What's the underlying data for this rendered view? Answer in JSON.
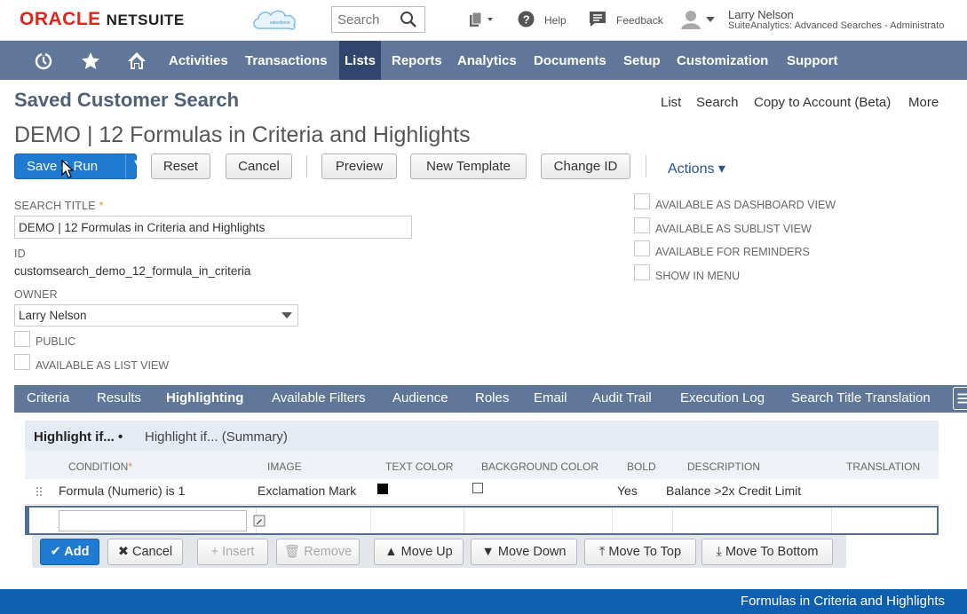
{
  "brand": {
    "oracle": "ORACLE",
    "netsuite": "NETSUITE"
  },
  "topbar": {
    "search_placeholder": "Search",
    "help_label": "Help",
    "feedback_label": "Feedback",
    "user_name": "Larry Nelson",
    "user_role": "SuiteAnalytics: Advanced Searches - Administrato",
    "icons": [
      "salesforce-cloud-icon",
      "search-icon",
      "create-new-icon",
      "help-icon",
      "feedback-icon",
      "user-icon"
    ]
  },
  "nav": {
    "icons": [
      "recent-records-icon",
      "favorites-star-icon",
      "home-icon"
    ],
    "items": [
      {
        "label": "Activities"
      },
      {
        "label": "Transactions"
      },
      {
        "label": "Lists",
        "active": true
      },
      {
        "label": "Reports"
      },
      {
        "label": "Analytics"
      },
      {
        "label": "Documents"
      },
      {
        "label": "Setup"
      },
      {
        "label": "Customization"
      },
      {
        "label": "Support"
      }
    ]
  },
  "page": {
    "type_title": "Saved Customer Search",
    "links": [
      "List",
      "Search",
      "Copy to Account (Beta)",
      "More"
    ],
    "record_title": "DEMO | 12 Formulas in Criteria and Highlights"
  },
  "buttons": {
    "save_run": "Save & Run",
    "reset": "Reset",
    "cancel": "Cancel",
    "preview": "Preview",
    "new_template": "New Template",
    "change_id": "Change ID",
    "actions": "Actions ▾"
  },
  "form": {
    "search_title_label": "SEARCH TITLE",
    "search_title_value": "DEMO | 12 Formulas in Criteria and Highlights",
    "id_label": "ID",
    "id_value": "customsearch_demo_12_formula_in_criteria",
    "owner_label": "OWNER",
    "owner_value": "Larry Nelson",
    "public_label": "PUBLIC",
    "list_view_label": "AVAILABLE AS LIST VIEW",
    "options": [
      "AVAILABLE AS DASHBOARD VIEW",
      "AVAILABLE AS SUBLIST VIEW",
      "AVAILABLE FOR REMINDERS",
      "SHOW IN MENU"
    ]
  },
  "subtabs": [
    {
      "label": "Criteria"
    },
    {
      "label": "Results"
    },
    {
      "label": "Highlighting",
      "active": true
    },
    {
      "label": "Available Filters"
    },
    {
      "label": "Audience"
    },
    {
      "label": "Roles"
    },
    {
      "label": "Email"
    },
    {
      "label": "Audit Trail"
    },
    {
      "label": "Execution Log"
    },
    {
      "label": "Search Title Translation"
    }
  ],
  "highlight_tabs": [
    {
      "label": "Highlight if... •",
      "active": true
    },
    {
      "label": "Highlight if... (Summary)"
    }
  ],
  "table": {
    "columns": [
      "CONDITION",
      "IMAGE",
      "TEXT COLOR",
      "BACKGROUND COLOR",
      "BOLD",
      "DESCRIPTION",
      "TRANSLATION"
    ],
    "rows": [
      {
        "condition": "Formula (Numeric) is 1",
        "image": "Exclamation Mark",
        "text_color": "#000000",
        "background_color": "#ffffff",
        "bold": "Yes",
        "description": "Balance >2x Credit Limit",
        "translation": ""
      }
    ]
  },
  "sublist_buttons": {
    "add": "Add",
    "cancel": "Cancel",
    "insert": "Insert",
    "remove": "Remove",
    "move_up": "Move Up",
    "move_down": "Move Down",
    "move_to_top": "Move To Top",
    "move_to_bottom": "Move To Bottom"
  },
  "footer": {
    "caption": "Formulas in Criteria and Highlights"
  },
  "colors": {
    "nav_bg": "#607799",
    "nav_active": "#30466d",
    "primary": "#1f7ad1",
    "footer": "#0f5fb1",
    "oracle_red": "#e2231a"
  }
}
